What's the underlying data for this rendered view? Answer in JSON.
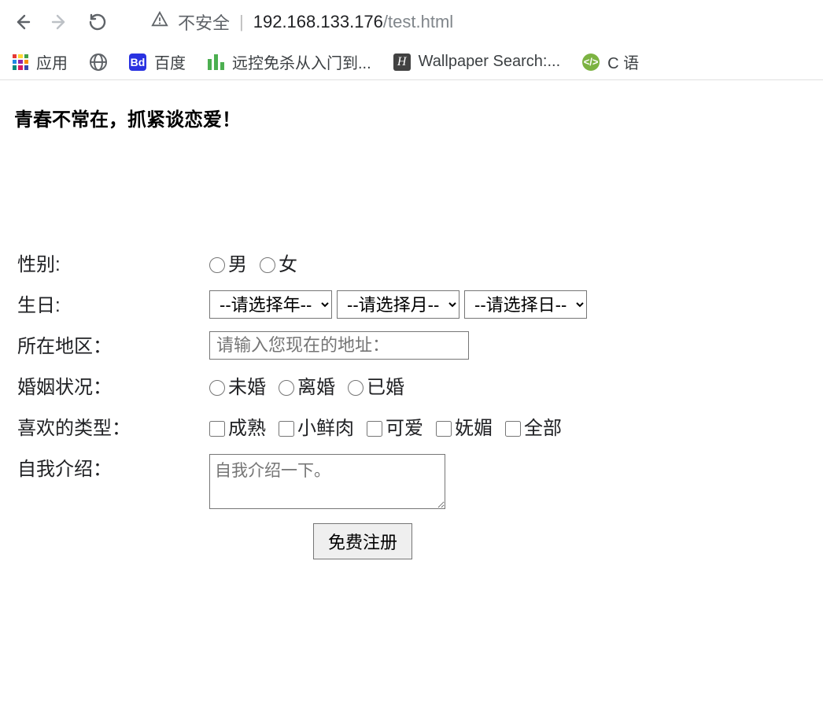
{
  "browser": {
    "security_label": "不安全",
    "url_host": "192.168.133.176",
    "url_path": "/test.html"
  },
  "bookmarks": {
    "apps": "应用",
    "baidu": "百度",
    "remote": "远控免杀从入门到...",
    "wallpaper": "Wallpaper Search:...",
    "clang": "C 语"
  },
  "page": {
    "title": "青春不常在，抓紧谈恋爱！"
  },
  "form": {
    "gender_label": "性别:",
    "gender_male": "男",
    "gender_female": "女",
    "birthday_label": "生日:",
    "year_placeholder": "--请选择年--",
    "month_placeholder": "--请选择月--",
    "day_placeholder": "--请选择日--",
    "region_label": "所在地区：",
    "region_placeholder": "请输入您现在的地址：",
    "marital_label": "婚姻状况：",
    "marital_single": "未婚",
    "marital_divorced": "离婚",
    "marital_married": "已婚",
    "type_label": "喜欢的类型：",
    "type_mature": "成熟",
    "type_fresh": "小鲜肉",
    "type_cute": "可爱",
    "type_charm": "妩媚",
    "type_all": "全部",
    "intro_label": "自我介绍：",
    "intro_placeholder": "自我介绍一下。",
    "submit": "免费注册"
  }
}
